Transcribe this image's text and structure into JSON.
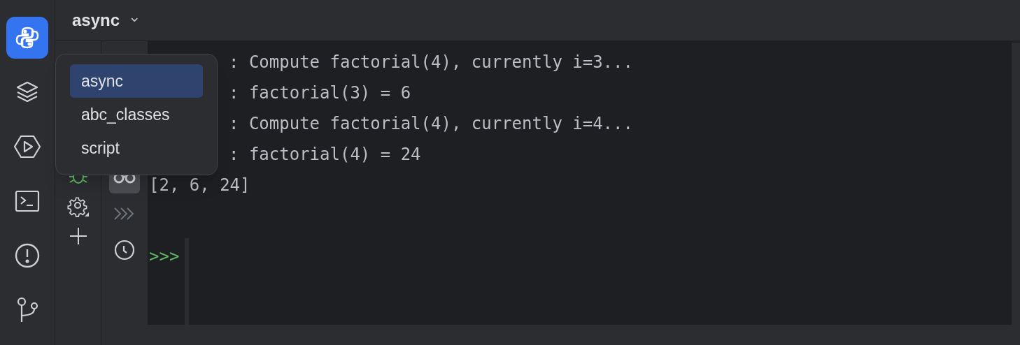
{
  "tool_windows": [
    {
      "selected": true
    },
    {
      "selected": false
    },
    {
      "selected": false
    },
    {
      "selected": false
    },
    {
      "selected": false
    },
    {
      "selected": false
    }
  ],
  "header": {
    "title": "async",
    "chevron": "⌄"
  },
  "console_actions": [
    {
      "selected": true
    },
    {
      "selected": false
    },
    {
      "selected": false
    }
  ],
  "console": {
    "lines": [
      {
        "text": ": Compute factorial(4), currently i=3...",
        "partly_hidden": true
      },
      {
        "text": ": factorial(3) = 6",
        "partly_hidden": true
      },
      {
        "text": ": Compute factorial(4), currently i=4...",
        "partly_hidden": true
      },
      {
        "text": ": factorial(4) = 24",
        "partly_hidden": true
      },
      {
        "text": "[2, 6, 24]",
        "partly_hidden": false
      }
    ],
    "prompt": ">>>"
  },
  "dropdown": {
    "items": [
      {
        "label": "async",
        "selected": true
      },
      {
        "label": "abc_classes",
        "selected": false
      },
      {
        "label": "script",
        "selected": false
      }
    ]
  }
}
